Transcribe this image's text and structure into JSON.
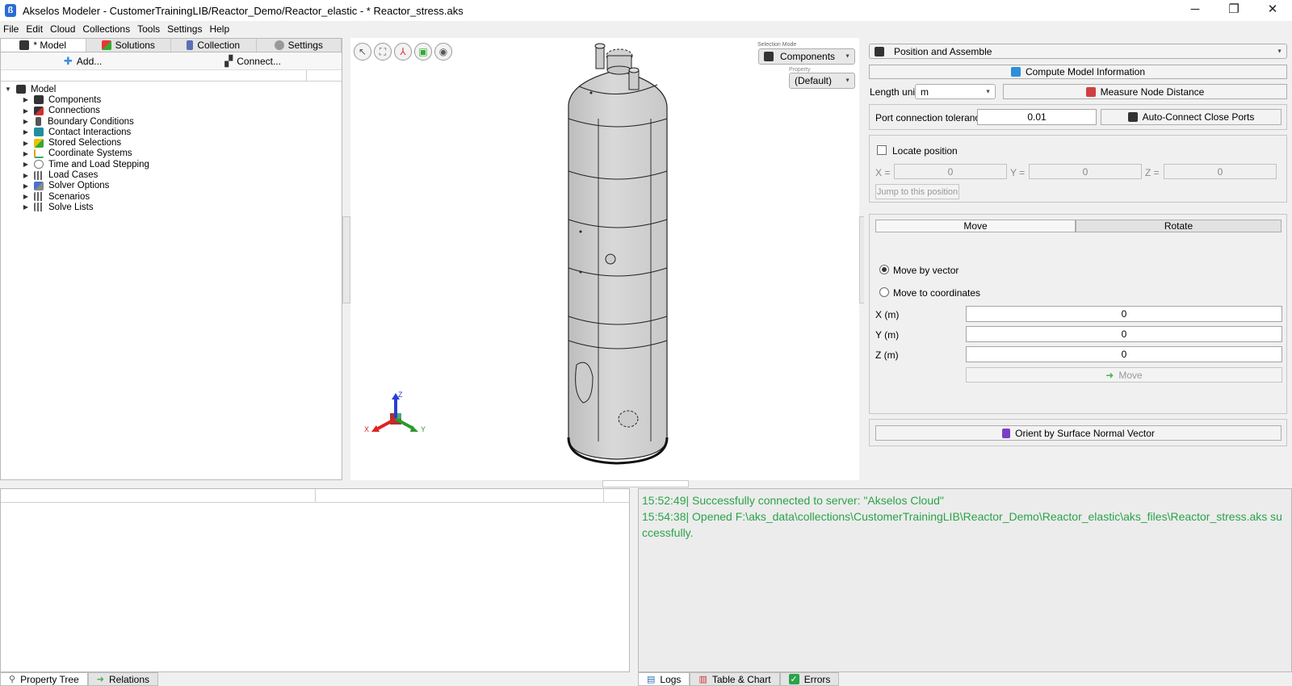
{
  "window": {
    "title": "Akselos Modeler - CustomerTrainingLIB/Reactor_Demo/Reactor_elastic - * Reactor_stress.aks",
    "minimize": "─",
    "maximize": "❐",
    "close": "✕"
  },
  "menu": [
    "File",
    "Edit",
    "Cloud",
    "Collections",
    "Tools",
    "Settings",
    "Help"
  ],
  "left_tabs": [
    "* Model",
    "Solutions",
    "Collection",
    "Settings"
  ],
  "left_actions": {
    "add": "Add...",
    "connect": "Connect..."
  },
  "tree": {
    "root": "Model",
    "items": [
      "Components",
      "Connections",
      "Boundary Conditions",
      "Contact Interactions",
      "Stored Selections",
      "Coordinate Systems",
      "Time and Load Stepping",
      "Load Cases",
      "Solver Options",
      "Scenarios",
      "Solve Lists"
    ]
  },
  "viewport": {
    "selection_mode_label": "Selection Mode",
    "selection_mode": "Components",
    "property_label": "Property",
    "property": "(Default)",
    "axes": {
      "x": "X",
      "y": "Y",
      "z": "Z"
    }
  },
  "right": {
    "panel_select": "Position and Assemble",
    "compute_btn": "Compute Model Information",
    "length_unit_label": "Length unit",
    "length_unit": "m",
    "measure_btn": "Measure Node Distance",
    "port_tol_label": "Port connection tolerance",
    "port_tol": "0.01",
    "auto_connect_btn": "Auto-Connect Close Ports",
    "locate_label": "Locate position",
    "x_eq": "X =",
    "y_eq": "Y =",
    "z_eq": "Z =",
    "loc_x": "0",
    "loc_y": "0",
    "loc_z": "0",
    "jump_btn": "Jump to this position",
    "seg_move": "Move",
    "seg_rotate": "Rotate",
    "move_by_vector": "Move by vector",
    "move_to_coords": "Move to coordinates",
    "x_label": "X (m)",
    "y_label": "Y (m)",
    "z_label": "Z (m)",
    "x_val": "0",
    "y_val": "0",
    "z_val": "0",
    "move_btn": "Move",
    "orient_btn": "Orient by Surface Normal Vector"
  },
  "logs": [
    "15:52:49| Successfully connected to server: \"Akselos Cloud\"",
    "15:54:38| Opened F:\\aks_data\\collections\\CustomerTrainingLIB\\Reactor_Demo\\Reactor_elastic\\aks_files\\Reactor_stress.aks su",
    "ccessfully."
  ],
  "bottom_left_tabs": [
    "Property Tree",
    "Relations"
  ],
  "bottom_right_tabs": [
    "Logs",
    "Table & Chart",
    "Errors"
  ]
}
